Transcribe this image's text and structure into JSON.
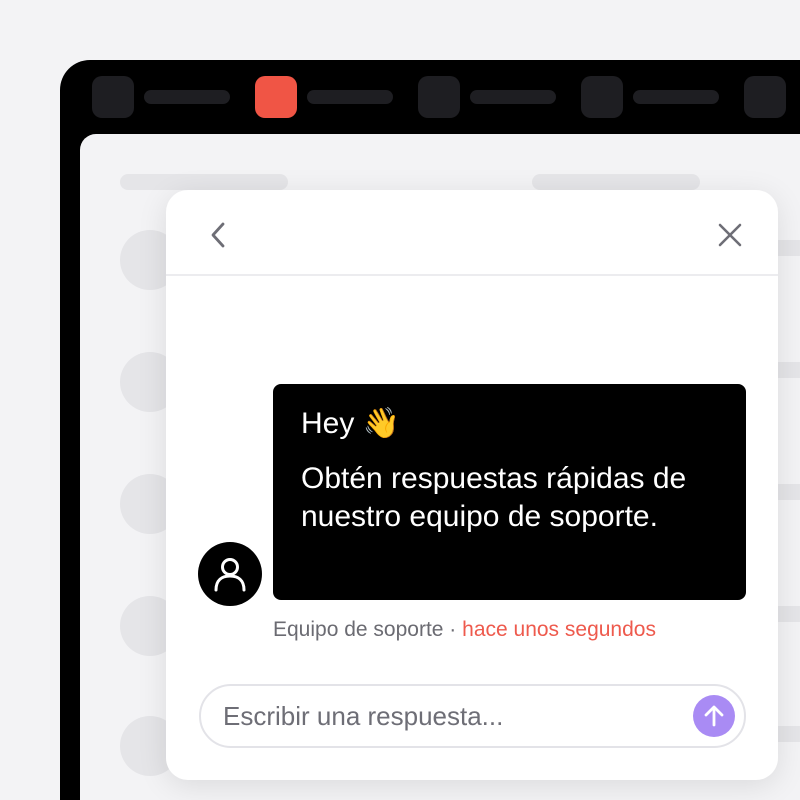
{
  "app": {
    "tabs": [
      {
        "icon": "app-tab-icon",
        "active": false
      },
      {
        "icon": "app-tab-icon",
        "active": true
      },
      {
        "icon": "app-tab-icon",
        "active": false
      },
      {
        "icon": "app-tab-icon",
        "active": false
      },
      {
        "icon": "app-tab-icon",
        "active": false
      }
    ]
  },
  "chat": {
    "header": {
      "back_icon": "chevron-left-icon",
      "close_icon": "close-icon"
    },
    "message": {
      "greeting": "Hey",
      "greeting_emoji": "👋",
      "body": "Obtén respuestas rápidas de nuestro equipo de soporte."
    },
    "meta": {
      "sender": "Equipo de soporte",
      "separator": " · ",
      "time": "hace unos segundos"
    },
    "composer": {
      "placeholder": "Escribir una respuesta...",
      "send_icon": "arrow-up-icon"
    },
    "avatar_icon": "user-icon"
  },
  "colors": {
    "accent": "#f05545",
    "send_button": "#a98bf4",
    "bubble_bg": "#000000",
    "timestamp": "#ee5a4d"
  }
}
